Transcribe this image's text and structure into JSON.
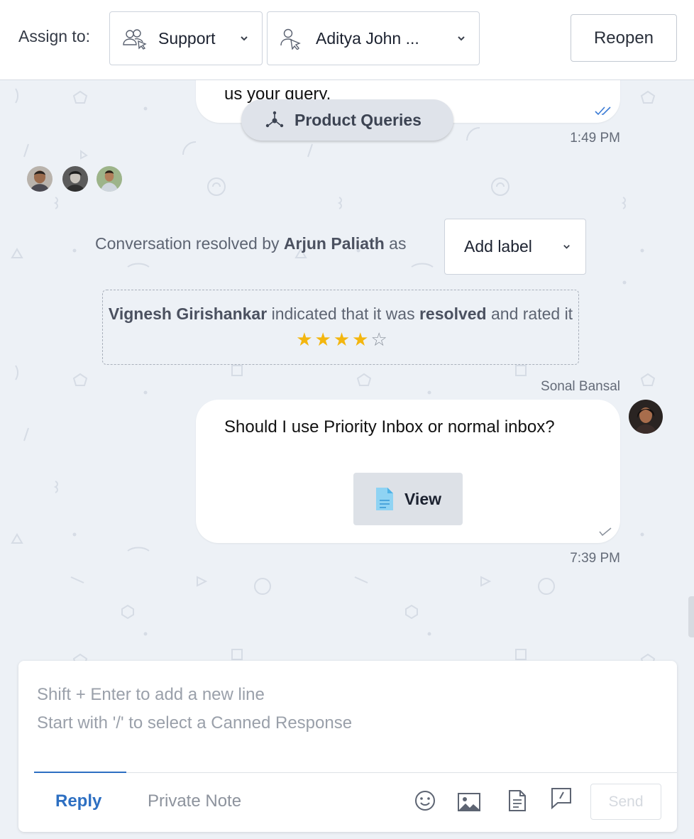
{
  "header": {
    "assign_label": "Assign to:",
    "team_value": "Support",
    "agent_value": "Aditya John ...",
    "reopen_label": "Reopen"
  },
  "conversation": {
    "prev_message_tail": "us your query.",
    "category_pill": "Product Queries",
    "prev_message_time": "1:49 PM",
    "resolution": {
      "prefix": "Conversation resolved by",
      "agent": "Arjun Paliath",
      "suffix": "as"
    },
    "add_label": "Add label",
    "rating": {
      "customer": "Vignesh Girishankar",
      "text_mid": "indicated that it was",
      "status": "resolved",
      "text_end": "and rated it",
      "stars": 4,
      "max_stars": 5
    },
    "message": {
      "sender": "Sonal Bansal",
      "text": "Should I use Priority Inbox or normal inbox?",
      "attachment_label": "View",
      "time": "7:39 PM"
    }
  },
  "composer": {
    "placeholder": "Shift + Enter to add a new line\nStart with '/' to select a Canned Response",
    "tab_reply": "Reply",
    "tab_private_note": "Private Note",
    "send_label": "Send"
  },
  "colors": {
    "accent": "#2d6fc2",
    "star": "#f3b60f",
    "background": "#edf1f6"
  }
}
